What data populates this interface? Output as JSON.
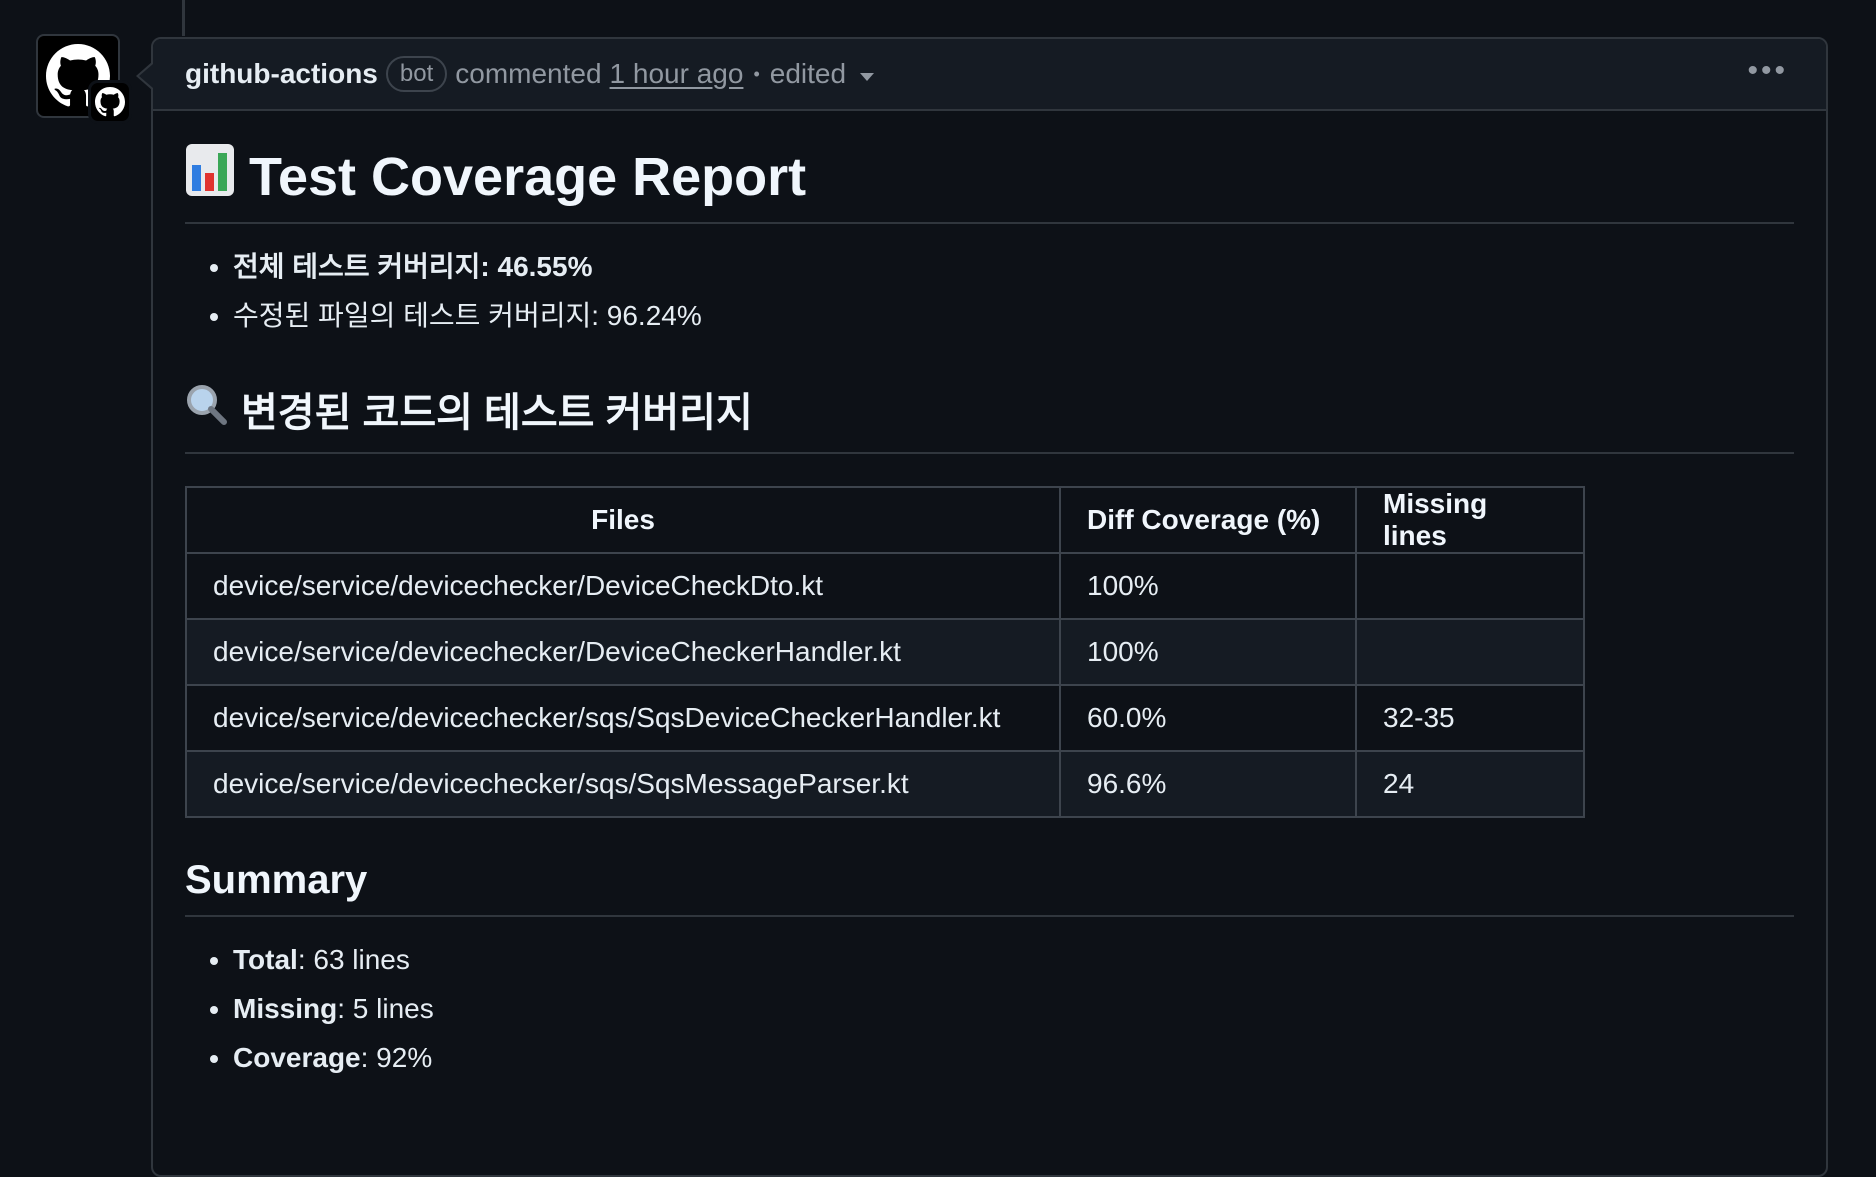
{
  "header": {
    "author": "github-actions",
    "badge": "bot",
    "action": "commented",
    "time": "1 hour ago",
    "separator": "•",
    "edited": "edited",
    "more": "•••"
  },
  "report": {
    "title": "Test Coverage Report",
    "title_icon": "bar-chart-icon",
    "total_coverage_label": "전체 테스트 커버리지: 46.55%",
    "modified_coverage_label": "수정된 파일의 테스트 커버리지: 96.24%"
  },
  "diff_section": {
    "heading": "변경된 코드의 테스트 커버리지",
    "heading_icon": "magnifier-icon",
    "columns": [
      "Files",
      "Diff Coverage (%)",
      "Missing lines"
    ],
    "rows": [
      {
        "file": "device/service/devicechecker/DeviceCheckDto.kt",
        "coverage": "100%",
        "missing": ""
      },
      {
        "file": "device/service/devicechecker/DeviceCheckerHandler.kt",
        "coverage": "100%",
        "missing": ""
      },
      {
        "file": "device/service/devicechecker/sqs/SqsDeviceCheckerHandler.kt",
        "coverage": "60.0%",
        "missing": "32-35"
      },
      {
        "file": "device/service/devicechecker/sqs/SqsMessageParser.kt",
        "coverage": "96.6%",
        "missing": "24"
      }
    ]
  },
  "summary": {
    "heading": "Summary",
    "items": [
      {
        "label": "Total",
        "value": ": 63 lines"
      },
      {
        "label": "Missing",
        "value": ": 5 lines"
      },
      {
        "label": "Coverage",
        "value": ": 92%"
      }
    ]
  },
  "colors": {
    "background": "#0d1117",
    "header_bg": "#151b23",
    "border": "#30363d",
    "text": "#e6edf3",
    "muted": "#9198a1"
  }
}
